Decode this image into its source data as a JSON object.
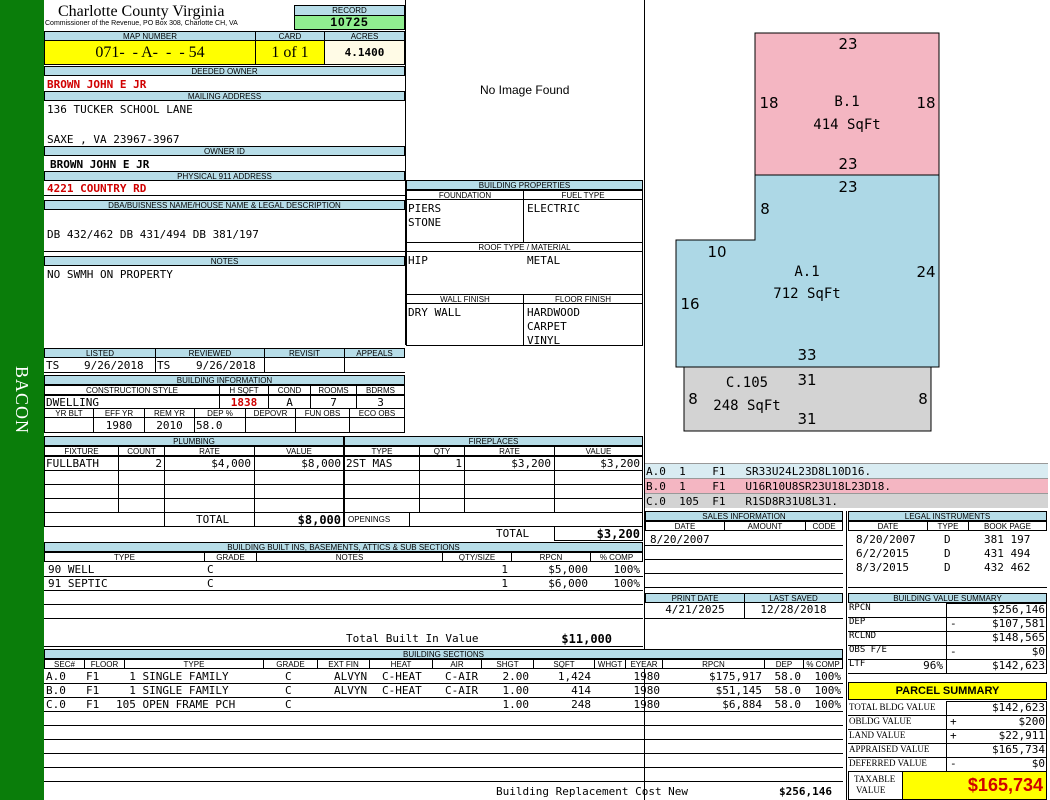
{
  "side_label": "BACON",
  "county": {
    "name": "Charlotte County Virginia",
    "sub": "Commissioner of the Revenue, PO Box 308, Charlotte CH, VA"
  },
  "record": {
    "label": "RECORD",
    "value": "10725"
  },
  "map": {
    "label": "MAP NUMBER",
    "value": "071-  - A-  -  - 54"
  },
  "card": {
    "label": "CARD",
    "value": "1 of 1"
  },
  "acres": {
    "label": "ACRES",
    "value": "4.1400"
  },
  "deeded_owner": {
    "label": "DEEDED OWNER",
    "value": "BROWN JOHN E JR"
  },
  "mailing": {
    "label": "MAILING ADDRESS",
    "line1": "136 TUCKER SCHOOL LANE",
    "line2": "SAXE , VA 23967-3967"
  },
  "owner_id": {
    "label": "OWNER ID",
    "value": "BROWN JOHN E JR"
  },
  "address911": {
    "label": "PHYSICAL 911 ADDRESS",
    "value": "4221 COUNTRY RD"
  },
  "dba": {
    "label": "DBA/BUISNESS NAME/HOUSE NAME & LEGAL DESCRIPTION",
    "value": "DB 432/462 DB 431/494 DB 381/197"
  },
  "notes": {
    "label": "NOTES",
    "value": "NO SWMH ON PROPERTY"
  },
  "image": {
    "text": "No Image Found"
  },
  "building_props": {
    "label": "BUILDING PROPERTIES",
    "foundation_label": "FOUNDATION",
    "fuel_label": "FUEL TYPE",
    "foundation1": "PIERS",
    "foundation2": "STONE",
    "fuel": "ELECTRIC",
    "roof_label": "ROOF TYPE / MATERIAL",
    "roof_type": "HIP",
    "roof_mat": "METAL",
    "wall_label": "WALL FINISH",
    "floor_label": "FLOOR FINISH",
    "wall": "DRY WALL",
    "floor1": "HARDWOOD",
    "floor2": "CARPET",
    "floor3": "VINYL"
  },
  "listed": {
    "label": "LISTED",
    "by": "TS",
    "date": "9/26/2018"
  },
  "reviewed": {
    "label": "REVIEWED",
    "by": "TS",
    "date": "9/26/2018"
  },
  "revisit": {
    "label": "REVISIT"
  },
  "appeals": {
    "label": "APPEALS"
  },
  "building_info": {
    "label": "BUILDING INFORMATION",
    "cs_label": "CONSTRUCTION STYLE",
    "hsqft_label": "H SQFT",
    "cond_label": "COND",
    "rooms_label": "ROOMS",
    "bdrms_label": "BDRMS",
    "cs": "DWELLING",
    "hsqft": "1838",
    "cond": "A",
    "rooms": "7",
    "bdrms": "3",
    "yrblt_label": "YR BLT",
    "effyr_label": "EFF YR",
    "remyr_label": "REM YR",
    "dep_label": "DEP %",
    "depovr_label": "DEPOVR",
    "funobs_label": "FUN OBS",
    "ecoobs_label": "ECO OBS",
    "yrblt": "",
    "effyr": "1980",
    "remyr": "2010",
    "dep": "58.0"
  },
  "plumbing": {
    "label": "PLUMBING",
    "cols": [
      "FIXTURE",
      "COUNT",
      "RATE",
      "VALUE"
    ],
    "rows": [
      {
        "fixture": "FULLBATH",
        "count": "2",
        "rate": "$4,000",
        "value": "$8,000"
      }
    ],
    "total_label": "TOTAL",
    "total": "$8,000"
  },
  "fireplaces": {
    "label": "FIREPLACES",
    "cols": [
      "TYPE",
      "QTY",
      "RATE",
      "VALUE"
    ],
    "rows": [
      {
        "type": "2ST MAS",
        "qty": "1",
        "rate": "$3,200",
        "value": "$3,200"
      }
    ],
    "openings_label": "OPENINGS",
    "total_label": "TOTAL",
    "total": "$3,200"
  },
  "built_ins": {
    "label": "BUILDING BUILT INS, BASEMENTS, ATTICS & SUB SECTIONS",
    "cols": [
      "TYPE",
      "GRADE",
      "NOTES",
      "QTY/SIZE",
      "RPCN",
      "% COMP"
    ],
    "rows": [
      {
        "type": "90 WELL",
        "grade": "C",
        "notes": "",
        "qty": "1",
        "rpcn": "$5,000",
        "comp": "100%"
      },
      {
        "type": "91 SEPTIC",
        "grade": "C",
        "notes": "",
        "qty": "1",
        "rpcn": "$6,000",
        "comp": "100%"
      }
    ],
    "total_label": "Total Built In Value",
    "total": "$11,000"
  },
  "sections": {
    "label": "BUILDING SECTIONS",
    "cols": [
      "SEC#",
      "FLOOR",
      "TYPE",
      "GRADE",
      "EXT FIN",
      "HEAT",
      "AIR",
      "SHGT",
      "SQFT",
      "WHGT",
      "EYEAR",
      "RPCN",
      "DEP",
      "% COMP"
    ],
    "rows": [
      {
        "sec": "A.0",
        "floor": "F1",
        "type": "  1 SINGLE FAMILY",
        "grade": "C",
        "ext": "ALVYN",
        "heat": "C-HEAT",
        "air": "C-AIR",
        "shgt": "2.00",
        "sqft": "1,424",
        "whgt": "",
        "eyear": "1980",
        "rpcn": "$175,917",
        "dep": "58.0",
        "comp": "100%"
      },
      {
        "sec": "B.0",
        "floor": "F1",
        "type": "  1 SINGLE FAMILY",
        "grade": "C",
        "ext": "ALVYN",
        "heat": "C-HEAT",
        "air": "C-AIR",
        "shgt": "1.00",
        "sqft": "414",
        "whgt": "",
        "eyear": "1980",
        "rpcn": "$51,145",
        "dep": "58.0",
        "comp": "100%"
      },
      {
        "sec": "C.0",
        "floor": "F1",
        "type": "105 OPEN FRAME PCH",
        "grade": "C",
        "ext": "",
        "heat": "",
        "air": "",
        "shgt": "1.00",
        "sqft": "248",
        "whgt": "",
        "eyear": "1980",
        "rpcn": "$6,884",
        "dep": "58.0",
        "comp": "100%"
      }
    ],
    "total_label": "Building Replacement Cost New",
    "total": "$256,146"
  },
  "sketch": {
    "areas": [
      {
        "name": "B.1",
        "sqft": "414 SqFt",
        "color": "#f4b6c2"
      },
      {
        "name": "A.1",
        "sqft": "712 SqFt",
        "color": "#add8e6"
      },
      {
        "name": "C.105",
        "sqft": "248 SqFt",
        "color": "#d3d3d3"
      }
    ],
    "dims": {
      "b_top": "23",
      "b_left": "18",
      "b_right": "18",
      "b_bottom": "23",
      "a_top": "23",
      "a_step": "8",
      "a_left_top": "10",
      "a_right": "24",
      "a_left": "16",
      "a_bottom": "33",
      "c_top": "31",
      "c_left": "8",
      "c_right": "8",
      "c_bottom": "31"
    }
  },
  "vectors": [
    {
      "text": "A.0  1    F1   SR33U24L23D8L10D16.",
      "color": "#d9ecf2"
    },
    {
      "text": "B.0  1    F1   U16R10U8SR23U18L23D18.",
      "color": "#f4b6c2"
    },
    {
      "text": "C.0  105  F1   R1SD8R31U8L31.",
      "color": "#d3d3d3"
    }
  ],
  "sales": {
    "label": "SALES INFORMATION",
    "cols": [
      "DATE",
      "AMOUNT",
      "CODE"
    ],
    "rows": [
      {
        "date": "8/20/2007",
        "amount": "",
        "code": ""
      }
    ]
  },
  "legal": {
    "label": "LEGAL INSTRUMENTS",
    "cols": [
      "DATE",
      "TYPE",
      "BOOK PAGE"
    ],
    "rows": [
      {
        "date": "8/20/2007",
        "type": "D",
        "book": "381 197"
      },
      {
        "date": "6/2/2015",
        "type": "D",
        "book": "431 494"
      },
      {
        "date": "8/3/2015",
        "type": "D",
        "book": "432 462"
      }
    ]
  },
  "print_date": {
    "label": "PRINT DATE",
    "value": "4/21/2025"
  },
  "last_saved": {
    "label": "LAST SAVED",
    "value": "12/28/2018"
  },
  "bvs": {
    "label": "BUILDING VALUE SUMMARY",
    "rows": [
      {
        "label": "RPCN",
        "sign": "",
        "value": "$256,146"
      },
      {
        "label": "DEP",
        "sign": "-",
        "value": "$107,581"
      },
      {
        "label": "RCLND",
        "sign": "",
        "value": "$148,565"
      },
      {
        "label": "OBS F/E",
        "sign": "-",
        "value": "$0"
      },
      {
        "label": "LTF",
        "sign": "96%",
        "value": "$142,623"
      }
    ]
  },
  "parcel": {
    "label": "PARCEL SUMMARY",
    "rows": [
      {
        "label": "TOTAL BLDG VALUE",
        "sign": "",
        "value": "$142,623"
      },
      {
        "label": "OBLDG VALUE",
        "sign": "+",
        "value": "$200"
      },
      {
        "label": "LAND VALUE",
        "sign": "+",
        "value": "$22,911"
      },
      {
        "label": "APPRAISED VALUE",
        "sign": "",
        "value": "$165,734"
      },
      {
        "label": "DEFERRED VALUE",
        "sign": "-",
        "value": "$0"
      }
    ],
    "taxable_label1": "TAXABLE",
    "taxable_label2": "VALUE",
    "taxable": "$165,734"
  }
}
